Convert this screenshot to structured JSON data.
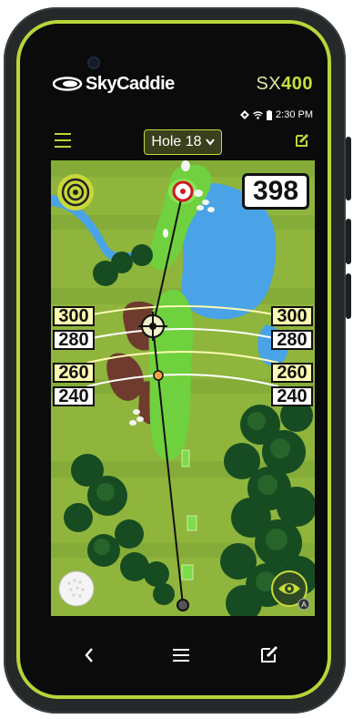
{
  "device": {
    "brand": "SkyCaddie",
    "model_prefix": "SX",
    "model_number": "400"
  },
  "status_bar": {
    "time": "2:30 PM",
    "icons": [
      "location-icon",
      "wifi-icon",
      "battery-icon"
    ]
  },
  "topbar": {
    "hole_label": "Hole 18",
    "icons": [
      "menu-icon",
      "chevron-down-icon",
      "edit-icon"
    ]
  },
  "map": {
    "distance_to_pin": "398",
    "arc_labels": [
      "300",
      "280",
      "260",
      "240"
    ],
    "buttons": [
      "target-icon",
      "golf-ball-icon",
      "eye-icon"
    ],
    "eye_badge": "A"
  },
  "colors": {
    "accent": "#b6d63a",
    "fairway": "#6fd13d",
    "rough": "#8fb53d",
    "water": "#4aa3e6"
  },
  "navbar": {
    "icons": [
      "back-icon",
      "menu-icon",
      "edit-icon"
    ]
  }
}
